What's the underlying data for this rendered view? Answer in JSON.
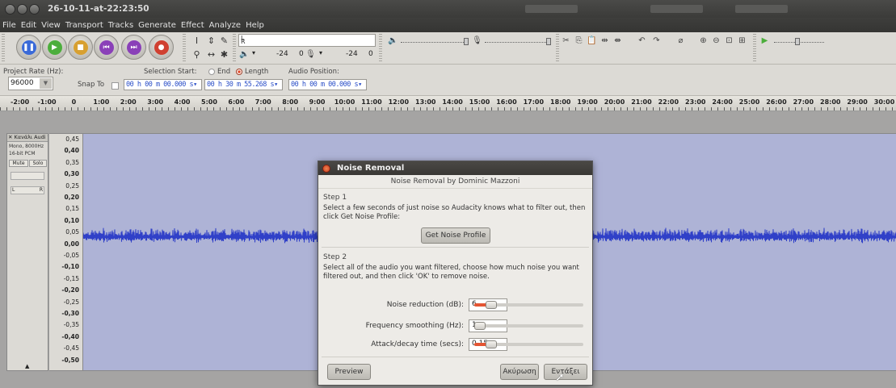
{
  "window": {
    "title": "26-10-11-at-22:23:50"
  },
  "menu": [
    "File",
    "Edit",
    "View",
    "Transport",
    "Tracks",
    "Generate",
    "Effect",
    "Analyze",
    "Help"
  ],
  "meters": {
    "rec_value_1": "-24",
    "rec_value_2": "0",
    "rec_value_3": "-24",
    "rec_value_4": "0",
    "left": "L",
    "right": "R"
  },
  "selection": {
    "project_rate_label": "Project Rate (Hz):",
    "project_rate": "96000",
    "snap_to_label": "Snap To",
    "selection_start_label": "Selection Start:",
    "end_label": "End",
    "length_label": "Length",
    "audio_position_label": "Audio Position:",
    "start_time": "00 h 00 m 00.000 s",
    "length_time": "00 h 30 m 55.268 s",
    "audio_position": "00 h 00 m 00.000 s"
  },
  "ruler": [
    "-2:00",
    "-1:00",
    "0",
    "1:00",
    "2:00",
    "3:00",
    "4:00",
    "5:00",
    "6:00",
    "7:00",
    "8:00",
    "9:00",
    "10:00",
    "11:00",
    "12:00",
    "13:00",
    "14:00",
    "15:00",
    "16:00",
    "17:00",
    "18:00",
    "19:00",
    "20:00",
    "21:00",
    "22:00",
    "23:00",
    "24:00",
    "25:00",
    "26:00",
    "27:00",
    "28:00",
    "29:00",
    "30:00"
  ],
  "track": {
    "name": "Κανάλι Audi",
    "format_line1": "Mono, 8000Hz",
    "format_line2": "16-bit PCM",
    "mute": "Mute",
    "solo": "Solo",
    "pan_left": "L",
    "pan_right": "R",
    "collapse": "▲"
  },
  "vruler": [
    "0,45",
    "0,40",
    "0,35",
    "0,30",
    "0,25",
    "0,20",
    "0,15",
    "0,10",
    "0,05",
    "0,00",
    "-0,05",
    "-0,10",
    "-0,15",
    "-0,20",
    "-0,25",
    "-0,30",
    "-0,35",
    "-0,40",
    "-0,45",
    "-0,50"
  ],
  "dialog": {
    "title": "Noise Removal",
    "subtitle": "Noise Removal by Dominic Mazzoni",
    "step1_label": "Step 1",
    "step1_text": "Select a few seconds of just noise so Audacity knows what to filter out, then click Get Noise Profile:",
    "get_profile_button": "Get Noise Profile",
    "step2_label": "Step 2",
    "step2_text": "Select all of the audio you want filtered, choose how much noise you want filtered out, and then click 'OK' to remove noise.",
    "rows": [
      {
        "label": "Noise reduction (dB):",
        "value": "6"
      },
      {
        "label": "Frequency smoothing (Hz):",
        "value": "1"
      },
      {
        "label": "Attack/decay time (secs):",
        "value": "0,15"
      }
    ],
    "preview_button": "Preview",
    "cancel_button": "Ακύρωση",
    "ok_button": "Εντάξει"
  },
  "colors": {
    "waveform": "#3040c8",
    "waveform_bg": "#aeb3d6",
    "accent": "#e45533"
  }
}
